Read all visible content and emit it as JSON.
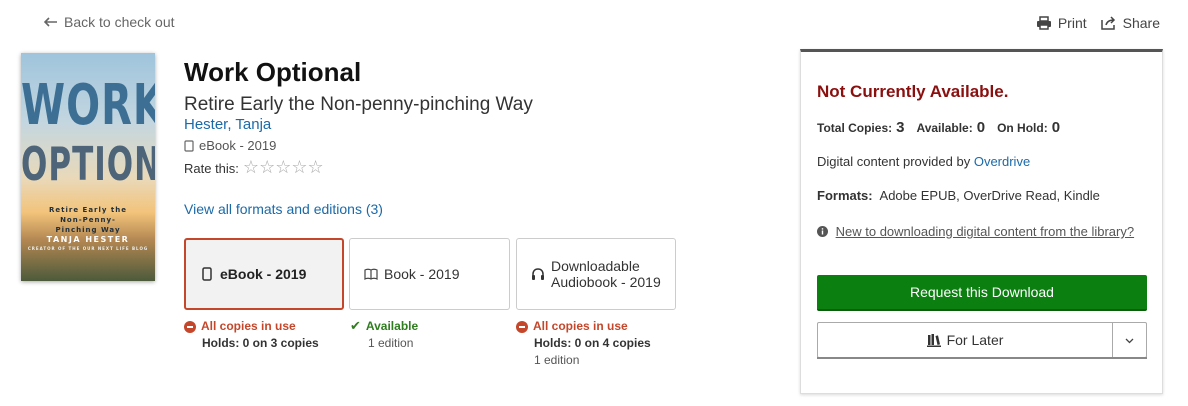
{
  "nav": {
    "back_label": "Back to check out",
    "print_label": "Print",
    "share_label": "Share"
  },
  "cover": {
    "line1": "WORK",
    "line2": "OPTIONAL",
    "tagline": "Retire Early the Non-Penny-Pinching Way",
    "author": "TANJA HESTER",
    "credit": "CREATOR OF THE OUR NEXT LIFE BLOG"
  },
  "book": {
    "title": "Work Optional",
    "subtitle": "Retire Early the Non-penny-pinching Way",
    "author": "Hester, Tanja",
    "format": "eBook - 2019",
    "rate_label": "Rate this:",
    "rating_max": 5,
    "rating_value": 0,
    "all_formats_label": "View all formats and editions (3)"
  },
  "formats": [
    {
      "label": "eBook - 2019",
      "icon": "ebook-icon",
      "selected": true,
      "status": "All copies in use",
      "status_type": "unavailable",
      "detail": "Holds: 0 on 3 copies",
      "editions": ""
    },
    {
      "label": "Book - 2019",
      "icon": "book-icon",
      "selected": false,
      "status": "Available",
      "status_type": "available",
      "detail": "",
      "editions": "1 edition"
    },
    {
      "label_line1": "Downloadable",
      "label_line2": "Audiobook - 2019",
      "icon": "headphones-icon",
      "selected": false,
      "status": "All copies in use",
      "status_type": "unavailable",
      "detail": "Holds: 0 on 4 copies",
      "editions": "1 edition"
    }
  ],
  "panel": {
    "status": "Not Currently Available.",
    "total_label": "Total Copies:",
    "total_value": "3",
    "available_label": "Available:",
    "available_value": "0",
    "hold_label": "On Hold:",
    "hold_value": "0",
    "digital_prefix": "Digital content provided by",
    "digital_provider": "Overdrive",
    "formats_label": "Formats:",
    "formats_value": "Adobe EPUB, OverDrive Read, Kindle",
    "help_text": "New to downloading digital content from the library?",
    "request_label": "Request this Download",
    "later_label": "For Later"
  },
  "colors": {
    "accent_red": "#c4472b",
    "status_red": "#8a0f0f",
    "green": "#0b7f10",
    "link": "#1b6aa8"
  }
}
